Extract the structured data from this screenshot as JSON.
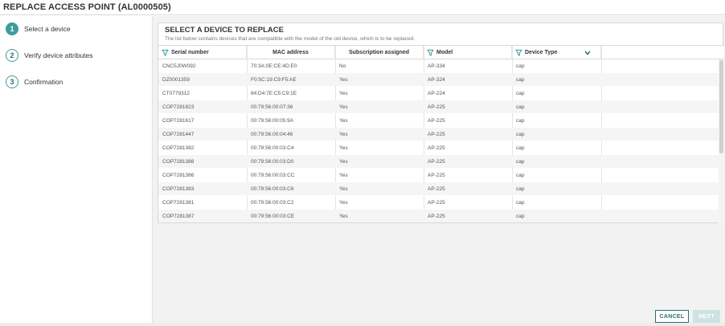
{
  "window": {
    "title": "REPLACE ACCESS POINT (AL0000505)"
  },
  "steps": [
    {
      "number": "1",
      "label": "Select a device",
      "active": true
    },
    {
      "number": "2",
      "label": "Verify device attributes",
      "active": false
    },
    {
      "number": "3",
      "label": "Confirmation",
      "active": false
    }
  ],
  "panel": {
    "heading": "SELECT A DEVICE TO REPLACE",
    "subheading": "The list below contains devices that are compatible with the model of the old device, which is to be replaced."
  },
  "table": {
    "columns": [
      {
        "label": "Serial number",
        "filter_icon": "filter-icon"
      },
      {
        "label": "MAC address"
      },
      {
        "label": "Subscription assigned"
      },
      {
        "label": "Model",
        "filter_icon": "filter-icon"
      },
      {
        "label": "Device Type",
        "filter_icon": "filter-icon",
        "menu_icon": "chevron-down-icon"
      }
    ],
    "rows": [
      [
        "CNC5J0W092",
        "70:3A:0E:CE:4D:E0",
        "No",
        "AP-334",
        "cap"
      ],
      [
        "DZ0001359",
        "F0:5C:19:C9:F5:AE",
        "Yes",
        "AP-324",
        "cap"
      ],
      [
        "CT0779312",
        "84:D4:7E:C5:C9:1E",
        "Yes",
        "AP-224",
        "cap"
      ],
      [
        "COP7281823",
        "00:79:56:00:07:36",
        "Yes",
        "AP-225",
        "cap"
      ],
      [
        "COP7281617",
        "00:79:56:00:05:9A",
        "Yes",
        "AP-225",
        "cap"
      ],
      [
        "COP7281447",
        "00:79:56:00:04:46",
        "Yes",
        "AP-225",
        "cap"
      ],
      [
        "COP7281382",
        "00:79:56:00:03:C4",
        "Yes",
        "AP-225",
        "cap"
      ],
      [
        "COP7281388",
        "00:79:56:00:03:D0",
        "Yes",
        "AP-225",
        "cap"
      ],
      [
        "COP7281386",
        "00:79:56:00:03:CC",
        "Yes",
        "AP-225",
        "cap"
      ],
      [
        "COP7281383",
        "00:79:56:00:03:C6",
        "Yes",
        "AP-225",
        "cap"
      ],
      [
        "COP7281381",
        "00:79:56:00:03:C2",
        "Yes",
        "AP-225",
        "cap"
      ],
      [
        "COP7281387",
        "00:79:56:00:03:CE",
        "Yes",
        "AP-225",
        "cap"
      ]
    ]
  },
  "buttons": {
    "cancel": "CANCEL",
    "next": "NEXT"
  },
  "colors": {
    "accent": "#3c9d9b",
    "accent_dark": "#2f6f6e",
    "disabled": "#cde3e2"
  }
}
